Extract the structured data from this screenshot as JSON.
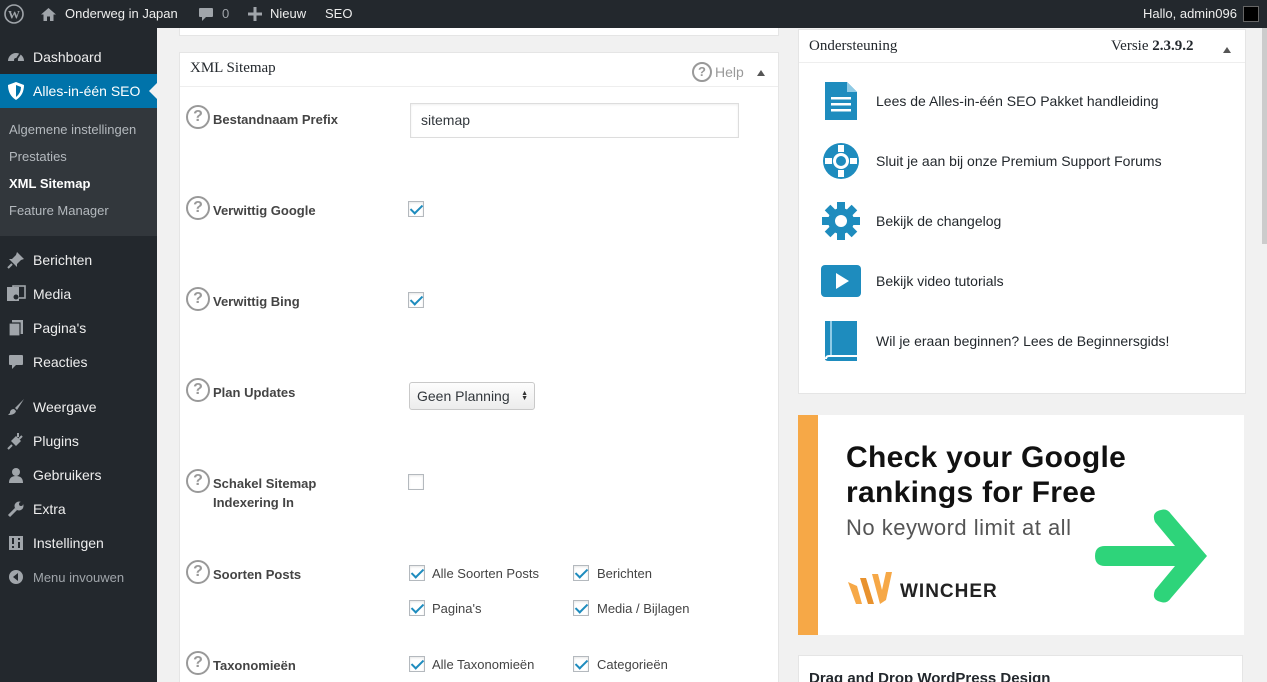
{
  "adminbar": {
    "site_name": "Onderweg in Japan",
    "comments_count": "0",
    "new_label": "Nieuw",
    "seo_label": "SEO",
    "greeting": "Hallo, admin096"
  },
  "sidebar": {
    "items": [
      {
        "label": "Dashboard",
        "icon": "dashboard-icon"
      },
      {
        "label": "Alles-in-één SEO",
        "icon": "shield-icon",
        "active": true
      },
      {
        "label": "Berichten",
        "icon": "pin-icon"
      },
      {
        "label": "Media",
        "icon": "media-icon"
      },
      {
        "label": "Pagina's",
        "icon": "pages-icon"
      },
      {
        "label": "Reacties",
        "icon": "comments-icon"
      },
      {
        "label": "Weergave",
        "icon": "brush-icon"
      },
      {
        "label": "Plugins",
        "icon": "plugin-icon"
      },
      {
        "label": "Gebruikers",
        "icon": "users-icon"
      },
      {
        "label": "Extra",
        "icon": "wrench-icon"
      },
      {
        "label": "Instellingen",
        "icon": "settings-icon"
      }
    ],
    "submenu": [
      {
        "label": "Algemene instellingen"
      },
      {
        "label": "Prestaties"
      },
      {
        "label": "XML Sitemap",
        "current": true
      },
      {
        "label": "Feature Manager"
      }
    ],
    "collapse_label": "Menu invouwen"
  },
  "main": {
    "box_title": "XML Sitemap",
    "help_label": "Help",
    "fields": {
      "prefix_label": "Bestandnaam Prefix",
      "prefix_value": "sitemap",
      "notify_google_label": "Verwittig Google",
      "notify_google_checked": true,
      "notify_bing_label": "Verwittig Bing",
      "notify_bing_checked": true,
      "plan_updates_label": "Plan Updates",
      "plan_updates_value": "Geen Planning",
      "indexing_label_1": "Schakel Sitemap",
      "indexing_label_2": "Indexering In",
      "indexing_checked": false,
      "post_types_label": "Soorten Posts",
      "post_types": [
        {
          "label": "Alle Soorten Posts",
          "checked": true
        },
        {
          "label": "Berichten",
          "checked": true
        },
        {
          "label": "Pagina's",
          "checked": true
        },
        {
          "label": "Media / Bijlagen",
          "checked": true
        }
      ],
      "taxonomies_label": "Taxonomieën",
      "taxonomies": [
        {
          "label": "Alle Taxonomieën",
          "checked": true
        },
        {
          "label": "Categorieën",
          "checked": true
        }
      ]
    }
  },
  "support": {
    "title": "Ondersteuning",
    "version_label": "Versie",
    "version": "2.3.9.2",
    "items": [
      {
        "label": "Lees de Alles-in-één SEO Pakket handleiding",
        "icon": "document-icon"
      },
      {
        "label": "Sluit je aan bij onze Premium Support Forums",
        "icon": "lifebuoy-icon"
      },
      {
        "label": "Bekijk de changelog",
        "icon": "gear-icon"
      },
      {
        "label": "Bekijk video tutorials",
        "icon": "play-icon"
      },
      {
        "label": "Wil je eraan beginnen? Lees de Beginnersgids!",
        "icon": "book-icon"
      }
    ]
  },
  "ad": {
    "headline_1": "Check your Google",
    "headline_2": "rankings for Free",
    "subline": "No keyword limit at all",
    "brand": "WINCHER",
    "accent_color": "#f6a847",
    "arrow_color": "#2ed47a"
  },
  "dragbox": {
    "title": "Drag and Drop WordPress Design"
  }
}
